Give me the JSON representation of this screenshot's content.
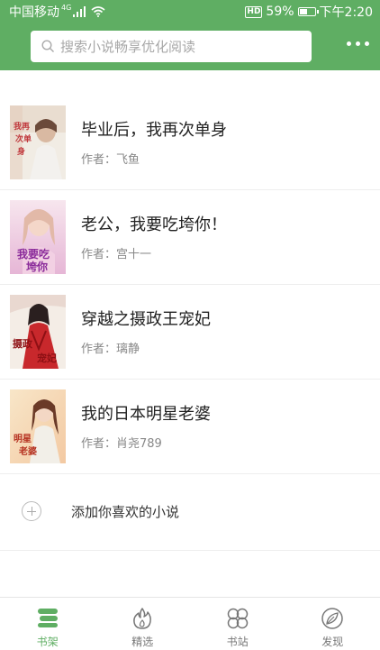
{
  "status_bar": {
    "carrier": "中国移动",
    "network": "4G",
    "hd": "HD",
    "battery_percent": "59%",
    "battery_level": 0.59,
    "time": "下午2:20"
  },
  "header": {
    "search_placeholder": "搜索小说畅享优化阅读",
    "accent_color": "#5fae63"
  },
  "books": [
    {
      "title": "毕业后，我再次单身",
      "author": "作者：飞鱼"
    },
    {
      "title": "老公，我要吃垮你！",
      "author": "作者：宫十一"
    },
    {
      "title": "穿越之摄政王宠妃",
      "author": "作者：璃静"
    },
    {
      "title": "我的日本明星老婆",
      "author": "作者：肖尧789"
    }
  ],
  "add_book": {
    "label": "添加你喜欢的小说"
  },
  "tabs": [
    {
      "label": "书架",
      "icon": "bookshelf-icon",
      "active": true
    },
    {
      "label": "精选",
      "icon": "flame-icon",
      "active": false
    },
    {
      "label": "书站",
      "icon": "grid-circles-icon",
      "active": false
    },
    {
      "label": "发现",
      "icon": "leaf-icon",
      "active": false
    }
  ]
}
